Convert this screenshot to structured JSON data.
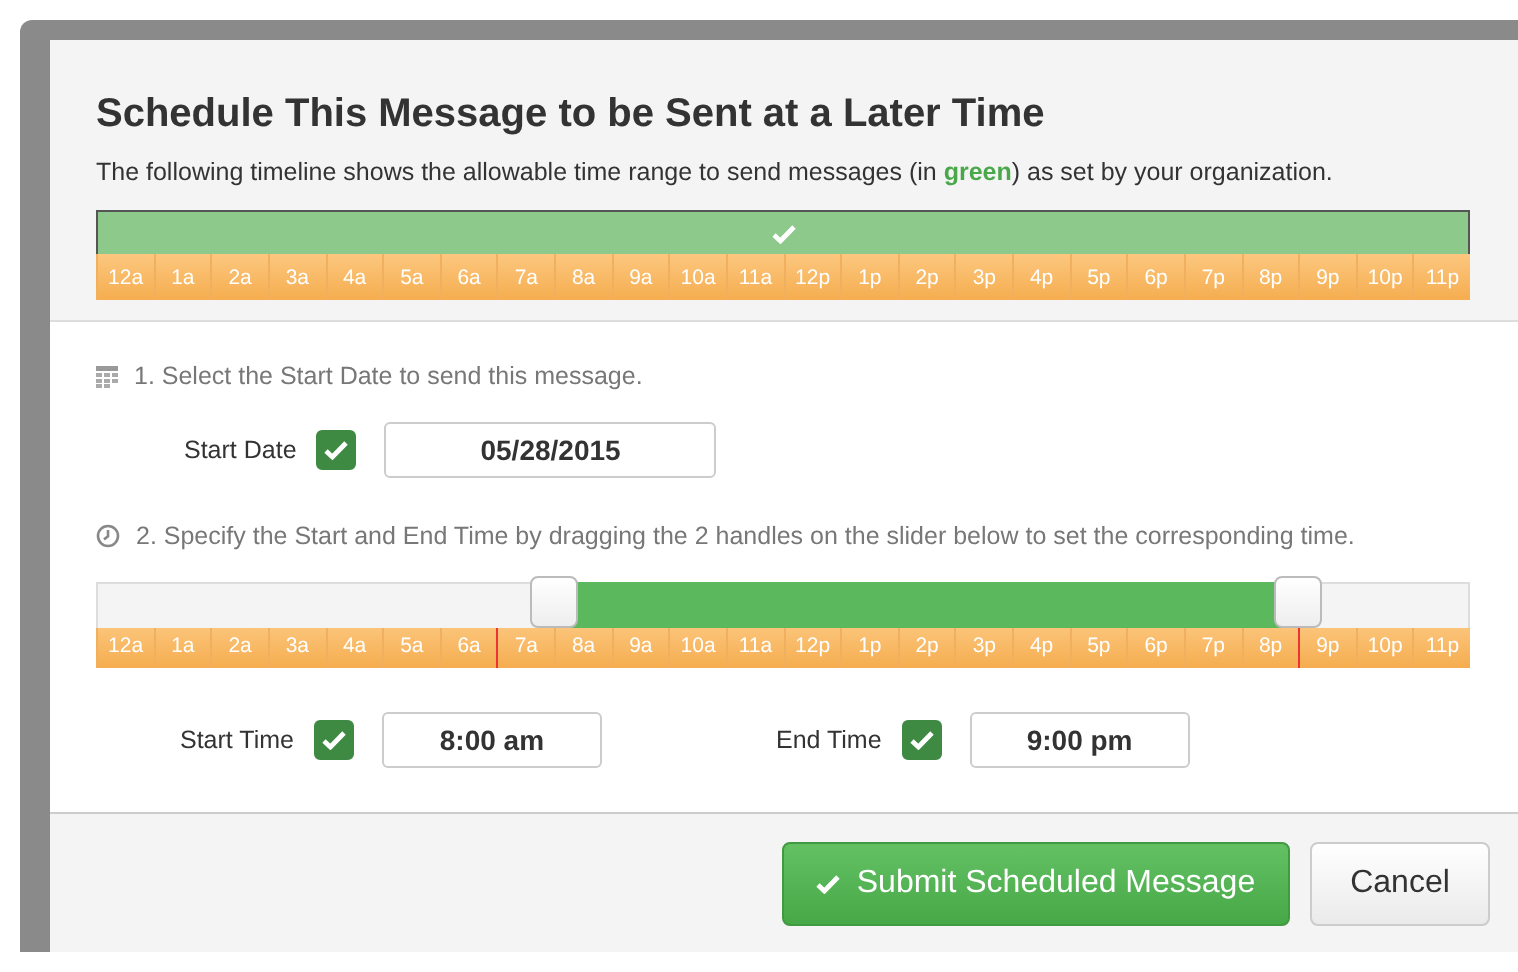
{
  "dialog": {
    "title": "Schedule This Message to be Sent at a Later Time",
    "description": "The following timeline shows the allowable time range to send messages (in **green**) as set by your organization."
  },
  "timeline": {
    "level": 1,
    "hours": [
      {
        "label": "12a"
      },
      {
        "label": "1a"
      },
      {
        "label": "2a"
      },
      {
        "label": "3a"
      },
      {
        "label": "4a"
      },
      {
        "label": "5a"
      },
      {
        "label": "6a"
      },
      {
        "label": "7a"
      },
      {
        "label": "8a"
      },
      {
        "label": "9a"
      },
      {
        "label": "10a"
      },
      {
        "label": "11a"
      },
      {
        "label": "12p"
      },
      {
        "label": "1p"
      },
      {
        "label": "2p"
      },
      {
        "label": "3p"
      },
      {
        "label": "4p"
      },
      {
        "label": "5p"
      },
      {
        "label": "6p"
      },
      {
        "label": "7p"
      },
      {
        "label": "8p"
      },
      {
        "label": "9p"
      },
      {
        "label": "10p"
      },
      {
        "label": "11p"
      }
    ]
  },
  "step_date": {
    "instruction": "1. Select the Start Date to send this message.",
    "label": "Start Date",
    "checked": true,
    "value": "05/28/2015"
  },
  "step_time": {
    "instruction": "2. Specify the Start and End Time by dragging the 2 handles on the slider below to set the corresponding time."
  },
  "slider": {
    "handles": [
      {
        "level": 0.3333
      },
      {
        "level": 0.875
      }
    ],
    "hours": [
      {
        "label": "12a",
        "marked": false
      },
      {
        "label": "1a",
        "marked": false
      },
      {
        "label": "2a",
        "marked": false
      },
      {
        "label": "3a",
        "marked": false
      },
      {
        "label": "4a",
        "marked": false
      },
      {
        "label": "5a",
        "marked": false
      },
      {
        "label": "6a",
        "marked": false
      },
      {
        "label": "7a",
        "marked": true
      },
      {
        "label": "8a",
        "marked": false
      },
      {
        "label": "9a",
        "marked": false
      },
      {
        "label": "10a",
        "marked": false
      },
      {
        "label": "11a",
        "marked": false
      },
      {
        "label": "12p",
        "marked": false
      },
      {
        "label": "1p",
        "marked": false
      },
      {
        "label": "2p",
        "marked": false
      },
      {
        "label": "3p",
        "marked": false
      },
      {
        "label": "4p",
        "marked": false
      },
      {
        "label": "5p",
        "marked": false
      },
      {
        "label": "6p",
        "marked": false
      },
      {
        "label": "7p",
        "marked": false
      },
      {
        "label": "8p",
        "marked": false
      },
      {
        "label": "9p",
        "marked": true
      },
      {
        "label": "10p",
        "marked": false
      },
      {
        "label": "11p",
        "marked": false
      }
    ]
  },
  "times": [
    {
      "label": "Start Time",
      "checked": true,
      "value": "8:00 am"
    },
    {
      "label": "End Time",
      "checked": true,
      "value": "9:00 pm"
    }
  ],
  "buttons": [
    {
      "kind": "primary",
      "label": "Submit Scheduled Message"
    },
    {
      "kind": "secondary",
      "label": "Cancel"
    }
  ]
}
